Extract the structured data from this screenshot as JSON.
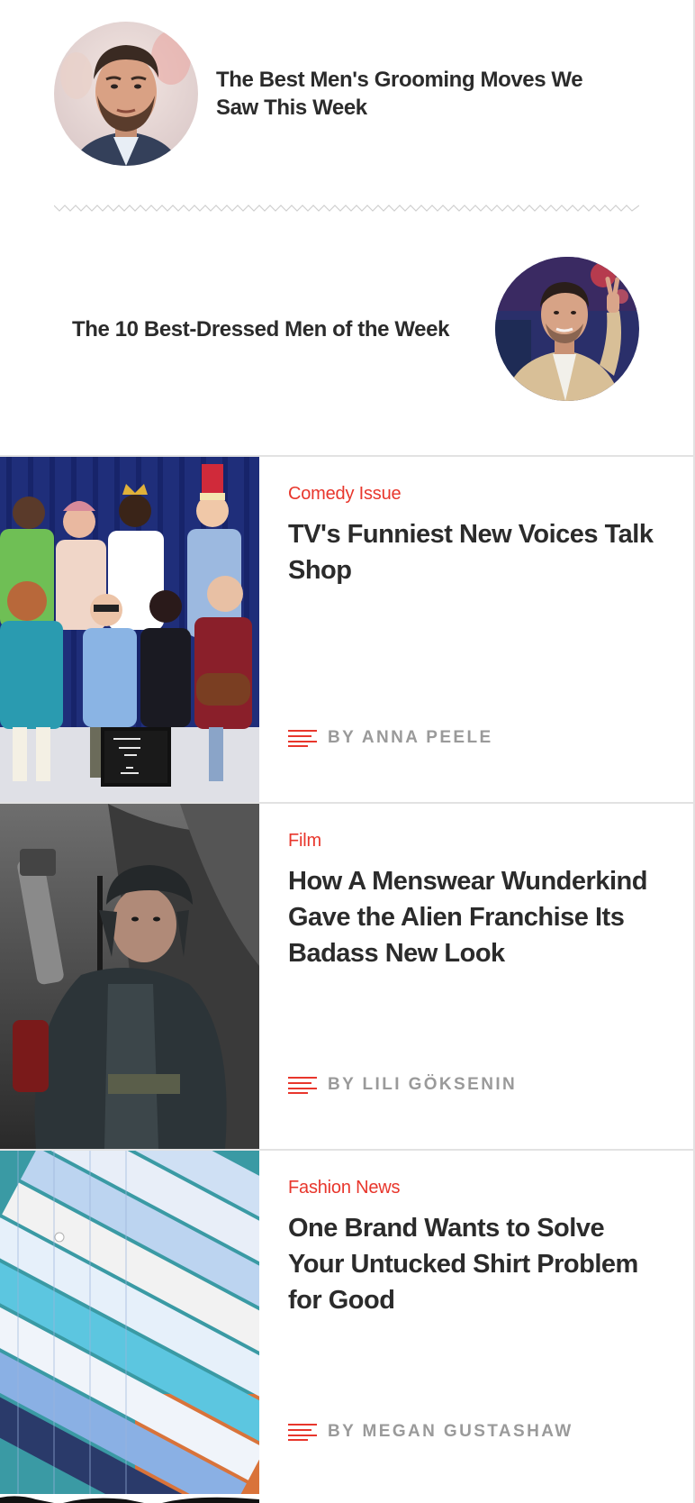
{
  "features": [
    {
      "title": "The Best Men's Grooming Moves We Saw This Week",
      "image_icon": "man-portrait-beard"
    },
    {
      "title": "The 10 Best-Dressed Men of the Week",
      "image_icon": "man-portrait-peace-sign"
    }
  ],
  "articles": [
    {
      "category": "Comedy Issue",
      "headline": "TV's Funniest New Voices Talk Shop",
      "byline": "BY ANNA PEELE",
      "image_icon": "group-photo-comedians"
    },
    {
      "category": "Film",
      "headline": "How A Menswear Wunderkind Gave the Alien Franchise Its Badass New Look",
      "byline": "BY LILI GÖKSENIN",
      "image_icon": "film-still-jacket"
    },
    {
      "category": "Fashion News",
      "headline": "One Brand Wants to Solve Your Untucked Shirt Problem for Good",
      "byline": "BY MEGAN GUSTASHAW",
      "image_icon": "folded-shirts-photo"
    }
  ],
  "colors": {
    "accent": "#e8362c",
    "headline": "#2b2b2b",
    "byline": "#9a9a9a",
    "divider": "#e2e2e2"
  }
}
